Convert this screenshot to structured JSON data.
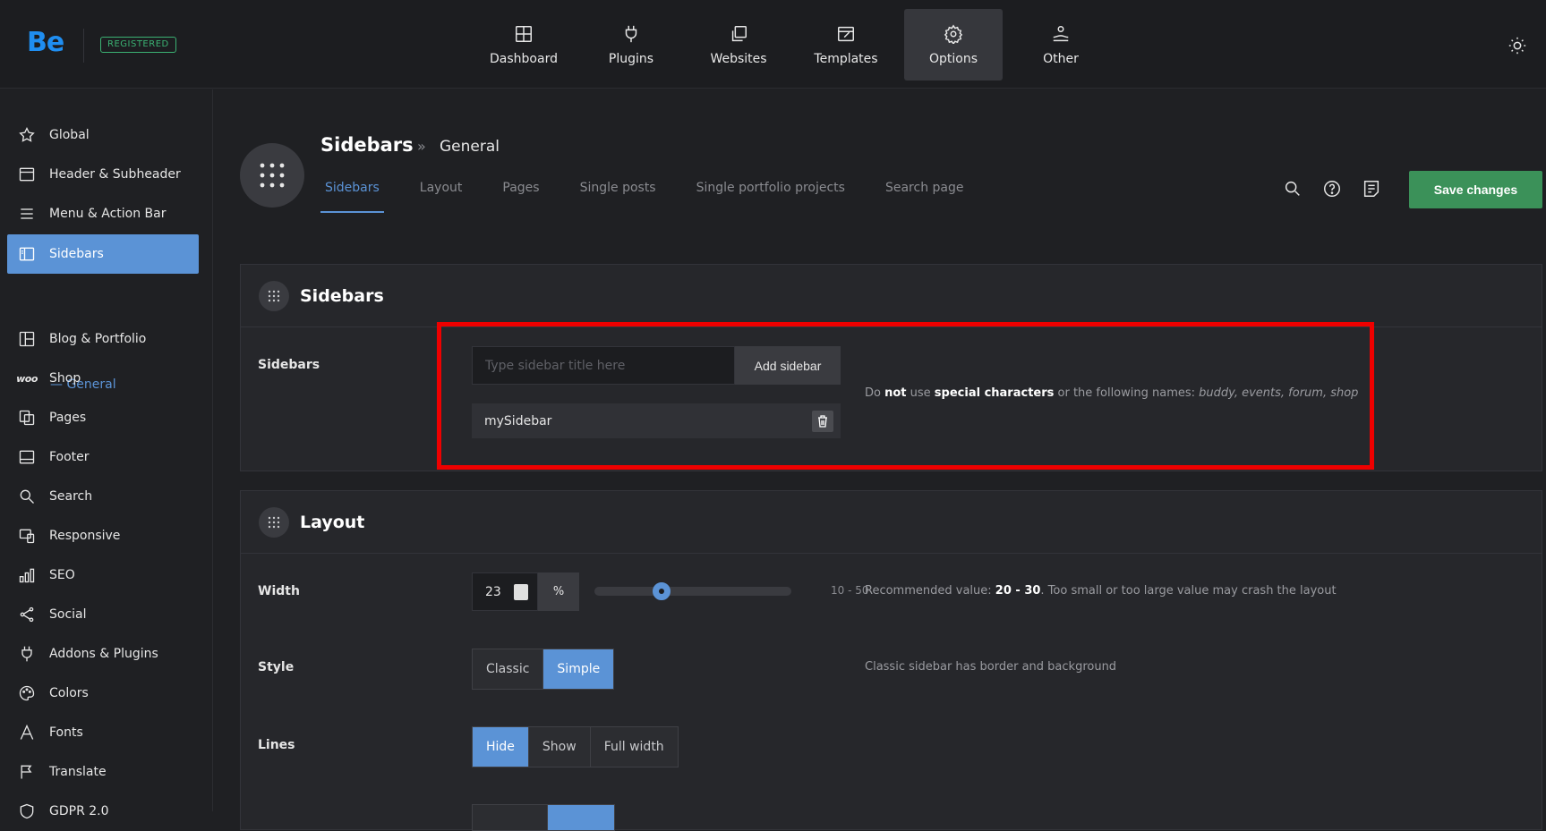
{
  "header": {
    "logo": "Be",
    "badge": "REGISTERED",
    "nav": [
      {
        "label": "Dashboard",
        "icon": "dashboard-icon"
      },
      {
        "label": "Plugins",
        "icon": "plug-icon"
      },
      {
        "label": "Websites",
        "icon": "copy-icon"
      },
      {
        "label": "Templates",
        "icon": "template-icon"
      },
      {
        "label": "Options",
        "icon": "gear-icon",
        "active": true
      },
      {
        "label": "Other",
        "icon": "hand-icon"
      }
    ]
  },
  "sidebar": {
    "items": [
      {
        "label": "Global",
        "icon": "star-icon"
      },
      {
        "label": "Header & Subheader",
        "icon": "header-icon"
      },
      {
        "label": "Menu & Action Bar",
        "icon": "menu-icon"
      },
      {
        "label": "Sidebars",
        "icon": "sidebar-icon",
        "active": true
      },
      {
        "label": "Blog & Portfolio",
        "icon": "grid-icon"
      },
      {
        "label": "Shop",
        "icon": "woo-icon"
      },
      {
        "label": "Pages",
        "icon": "pages-icon"
      },
      {
        "label": "Footer",
        "icon": "footer-icon"
      },
      {
        "label": "Search",
        "icon": "search-icon"
      },
      {
        "label": "Responsive",
        "icon": "responsive-icon"
      },
      {
        "label": "SEO",
        "icon": "seo-icon"
      },
      {
        "label": "Social",
        "icon": "share-icon"
      },
      {
        "label": "Addons & Plugins",
        "icon": "plug-icon"
      },
      {
        "label": "Colors",
        "icon": "palette-icon"
      },
      {
        "label": "Fonts",
        "icon": "font-icon"
      },
      {
        "label": "Translate",
        "icon": "flag-icon"
      },
      {
        "label": "GDPR 2.0",
        "icon": "shield-icon"
      }
    ],
    "sub_item": "General",
    "woo_text": "woo"
  },
  "page": {
    "title": "Sidebars",
    "breadcrumb_sep": "»",
    "subtitle": "General",
    "tabs": [
      "Sidebars",
      "Layout",
      "Pages",
      "Single posts",
      "Single portfolio projects",
      "Search page"
    ],
    "active_tab": 0,
    "save_label": "Save changes"
  },
  "sidebars_card": {
    "title": "Sidebars",
    "row_label": "Sidebars",
    "input_placeholder": "Type sidebar title here",
    "add_label": "Add sidebar",
    "items": [
      "mySidebar"
    ],
    "hint_pre": "Do ",
    "hint_not": "not",
    "hint_mid1": " use ",
    "hint_special": "special characters",
    "hint_mid2": " or the following names: ",
    "hint_names": "buddy, events, forum, shop"
  },
  "layout_card": {
    "title": "Layout",
    "width_label": "Width",
    "width_value": "23",
    "width_unit": "%",
    "width_min": 10,
    "width_max": 50,
    "width_range": "10 - 50",
    "width_hint_pre": "Recommended value: ",
    "width_hint_bold": "20 - 30",
    "width_hint_post": ". Too small or too large value may crash the layout",
    "style_label": "Style",
    "style_options": [
      "Classic",
      "Simple"
    ],
    "style_selected": 1,
    "style_hint": "Classic sidebar has border and background",
    "lines_label": "Lines",
    "lines_options": [
      "Hide",
      "Show",
      "Full width"
    ],
    "lines_selected": 0
  },
  "colors": {
    "accent": "#5b93d6",
    "save": "#3b9159",
    "highlight": "#ee0000",
    "logo": "#1f8ef1"
  }
}
